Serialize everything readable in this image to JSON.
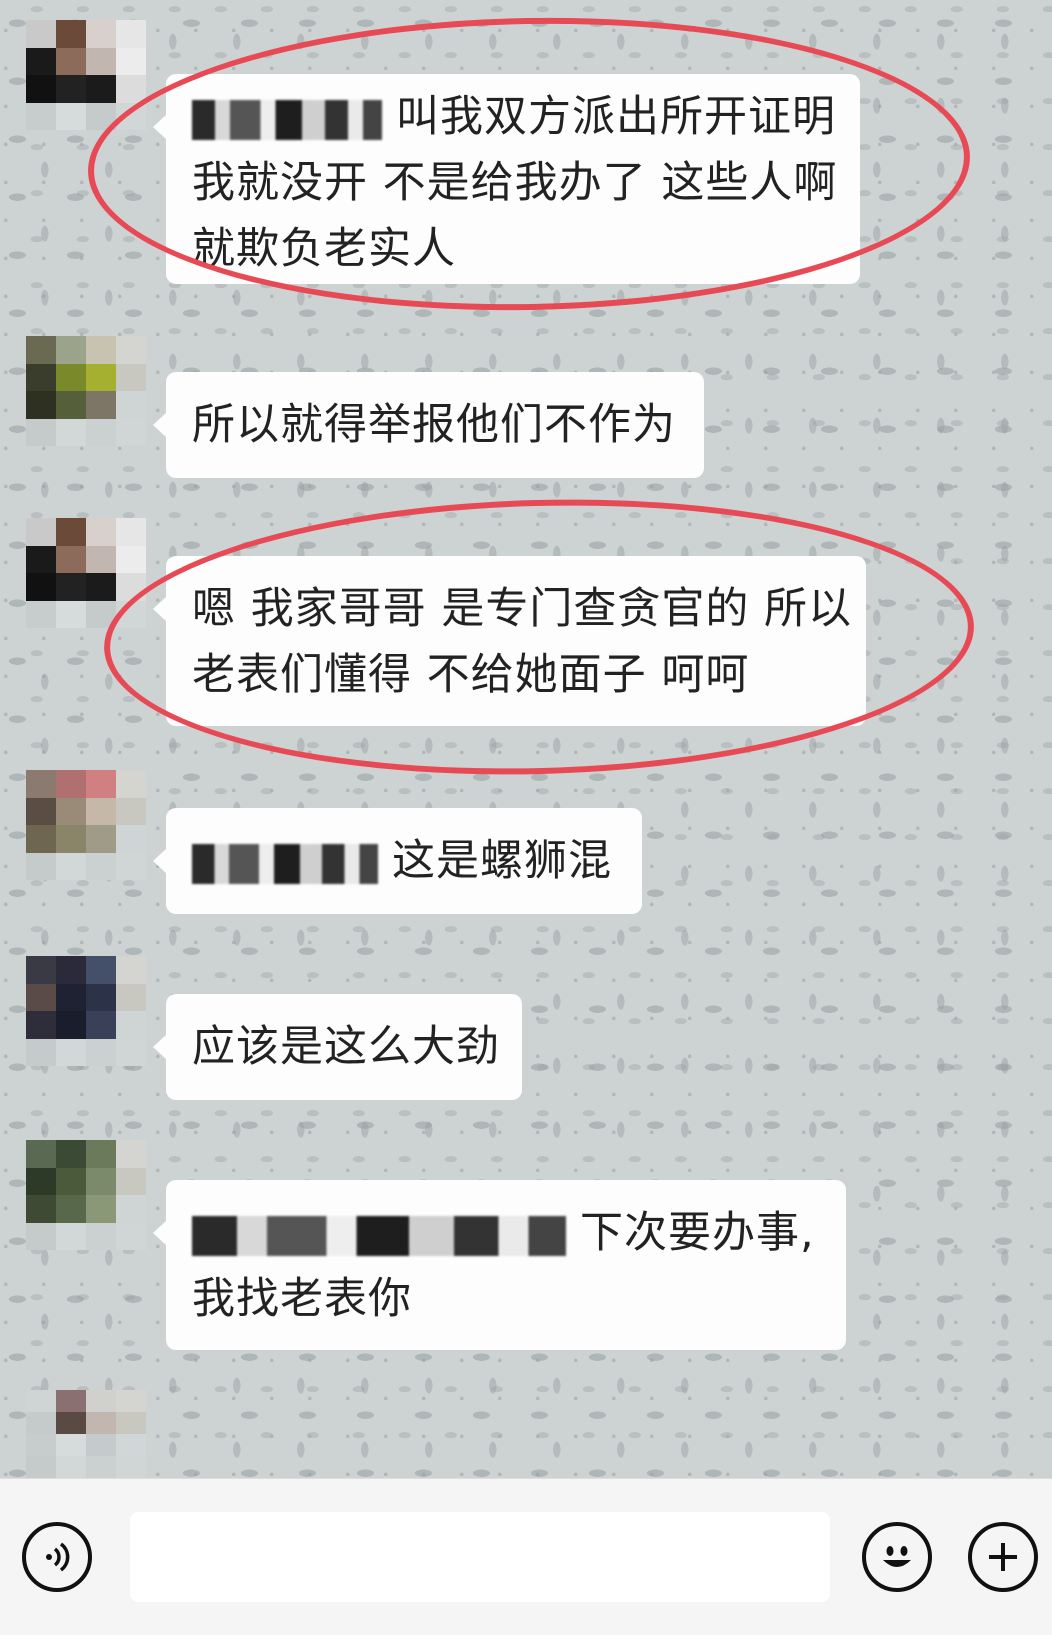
{
  "messages": [
    {
      "redacted_prefix": true,
      "lines": [
        "叫我双方派出所开证明",
        "我就没开 不是给我办了 这些人啊",
        "就欺负老实人"
      ]
    },
    {
      "redacted_prefix": false,
      "lines": [
        "所以就得举报他们不作为"
      ]
    },
    {
      "redacted_prefix": false,
      "lines": [
        "嗯 我家哥哥 是专门查贪官的 所以",
        "老表们懂得 不给她面子 呵呵"
      ]
    },
    {
      "redacted_prefix": true,
      "lines": [
        "这是螺狮混"
      ]
    },
    {
      "redacted_prefix": false,
      "lines": [
        "应该是这么大劲"
      ]
    },
    {
      "redacted_prefix": true,
      "lines": [
        "下次要办事,",
        "我找老表你"
      ]
    }
  ],
  "input_bar": {
    "input_value": "",
    "icons": [
      "voice-icon",
      "emoji-icon",
      "plus-icon"
    ]
  },
  "colors": {
    "bubble": "#fdfdfd",
    "annotation_circle": "#e84a55",
    "chat_background": "#cdd3d3"
  }
}
